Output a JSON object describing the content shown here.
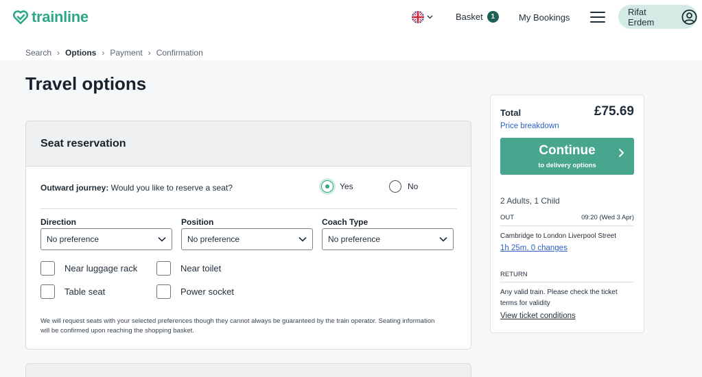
{
  "header": {
    "logo": "trainline",
    "basket_label": "Basket",
    "basket_count": "1",
    "bookings_label": "My Bookings",
    "account_name": "Rifat Erdem",
    "brand_color": "#2ea787"
  },
  "breadcrumb": [
    "Search",
    "Options",
    "Payment",
    "Confirmation"
  ],
  "page_title": "Travel options",
  "seat": {
    "title": "Seat reservation",
    "question_bold": "Outward journey:",
    "question_text": " Would you like to reserve a seat?",
    "yes_label": "Yes",
    "no_label": "No",
    "selected": "Yes",
    "direction_label": "Direction",
    "direction_value": "No preference",
    "position_label": "Position",
    "position_value": "No preference",
    "coach_label": "Coach Type",
    "coach_value": "No preference",
    "options": [
      "Near luggage rack",
      "Near toilet",
      "Table seat",
      "Power socket"
    ],
    "note": "We will request seats with your selected preferences though they cannot always be guaranteed by the train operator. Seating information will be confirmed upon reaching the shopping basket."
  },
  "summary": {
    "total_label": "Total",
    "total_price": "£75.69",
    "breakdown_link": "Price breakdown",
    "continue_label": "Continue",
    "continue_sub": "to delivery options",
    "passengers": "2 Adults, 1 Child",
    "out_label": "OUT",
    "out_time": "09:20 (Wed 3 Apr)",
    "out_route": "Cambridge to London Liverpool Street",
    "out_duration": "1h 25m, 0 changes",
    "return_label": "RETURN",
    "return_text": "Any valid train. Please check the ticket terms for validity",
    "ticket_conditions": "View ticket conditions"
  }
}
